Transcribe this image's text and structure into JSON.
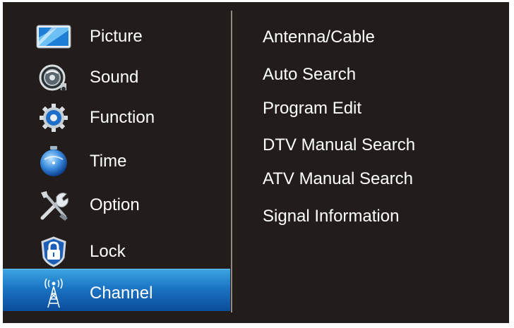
{
  "left_menu": {
    "items": [
      {
        "label": "Picture",
        "icon": "picture-icon"
      },
      {
        "label": "Sound",
        "icon": "sound-icon"
      },
      {
        "label": "Function",
        "icon": "function-icon"
      },
      {
        "label": "Time",
        "icon": "time-icon"
      },
      {
        "label": "Option",
        "icon": "option-icon"
      },
      {
        "label": "Lock",
        "icon": "lock-icon"
      },
      {
        "label": "Channel",
        "icon": "channel-icon",
        "selected": true
      }
    ]
  },
  "channel_menu": {
    "items": [
      {
        "label": "Antenna/Cable"
      },
      {
        "label": "Auto Search"
      },
      {
        "label": "Program Edit"
      },
      {
        "label": "DTV Manual Search"
      },
      {
        "label": "ATV Manual Search"
      },
      {
        "label": "Signal Information"
      }
    ]
  },
  "colors": {
    "background": "#221c1a",
    "selected_highlight": "#1c74c4",
    "text": "#ffffff"
  }
}
